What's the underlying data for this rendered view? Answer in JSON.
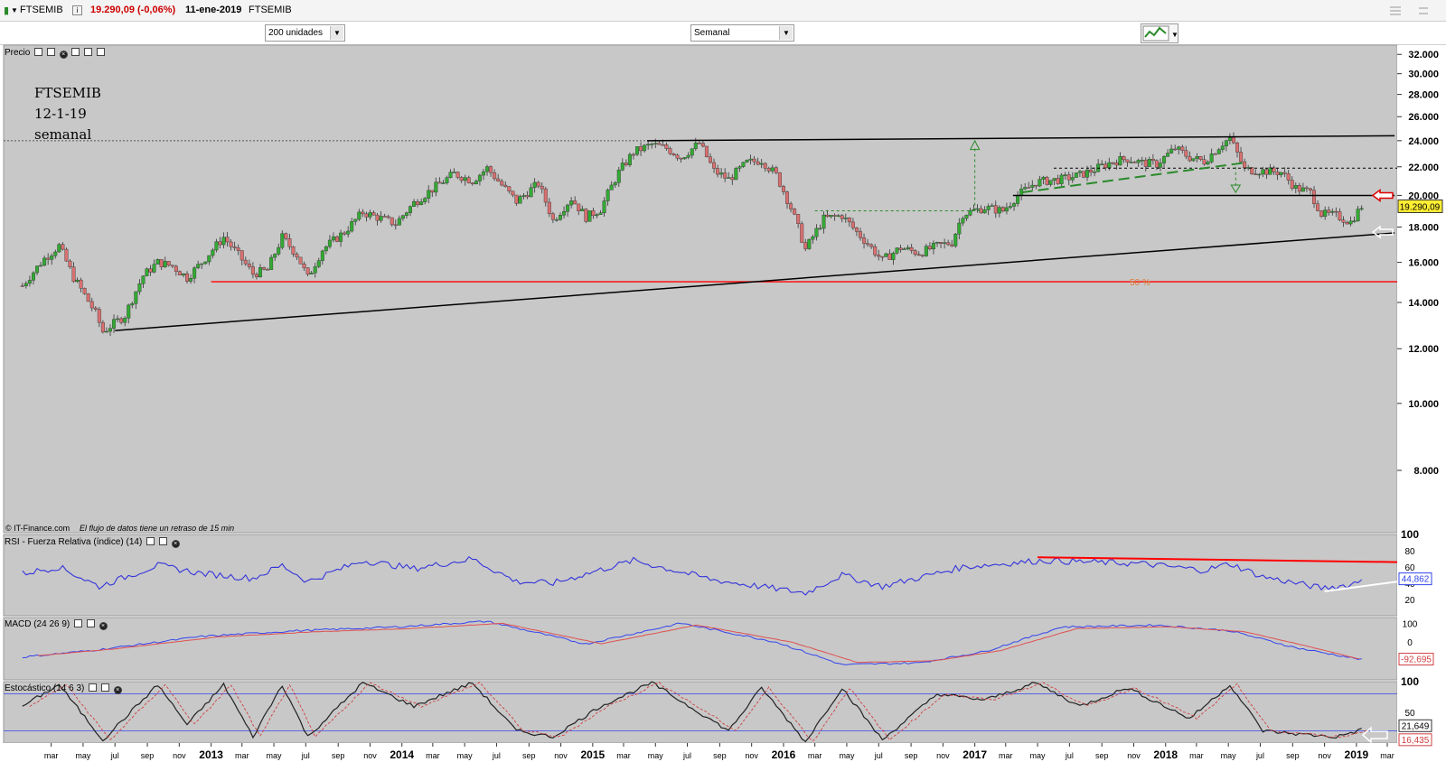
{
  "titlebar": {
    "symbol": "FTSEMIB",
    "quote": "19.290,09 (-0,06%)",
    "date": "11-ene-2019",
    "symbol_right": "FTSEMIB"
  },
  "toolbar": {
    "units_select": "200 unidades",
    "period_select": "Semanal"
  },
  "annotation": {
    "line1": "FTSEMIB",
    "line2": "12-1-19",
    "line3": "semanal"
  },
  "fib_label": "50 %",
  "copyright": "© IT-Finance.com",
  "delay_note": "El flujo de datos tiene un retraso de 15 min",
  "price_panel": {
    "label": "Precio",
    "last_value": "19.290,09"
  },
  "rsi_panel": {
    "label": "RSI - Fuerza Relativa (índice) (14)",
    "last_value": "44,862"
  },
  "macd_panel": {
    "label": "MACD (24 26 9)",
    "last_value": "-92,695"
  },
  "stoch_panel": {
    "label": "Estocástico (14 6 3)",
    "last_value_k": "21,649",
    "last_value_d": "16,435"
  },
  "colors": {
    "chart_bg": "#c8c8c8",
    "up_candle": "#33aa33",
    "down_candle": "#d97070",
    "trendline": "#000000",
    "support_red": "#ff0000",
    "rsi_line": "#3333dd",
    "macd_line": "#3344ee",
    "signal_line": "#e05050",
    "fib_dashed": "#2a8a2a"
  },
  "chart_data": {
    "type": "candlestick",
    "title": "FTSEMIB",
    "period": "semanal",
    "price_axis_ticks": [
      "8.000",
      "10.000",
      "12.000",
      "14.000",
      "16.000",
      "18.000",
      "20.000",
      "22.000",
      "24.000",
      "26.000",
      "28.000",
      "30.000",
      "32.000"
    ],
    "price_axis_values": [
      8000,
      10000,
      12000,
      14000,
      16000,
      18000,
      20000,
      22000,
      24000,
      26000,
      28000,
      30000,
      32000
    ],
    "ylim": [
      6500,
      33000
    ],
    "scale": "log",
    "x_axis_ticks": [
      "mar",
      "may",
      "jul",
      "sep",
      "nov",
      "2013",
      "mar",
      "may",
      "jul",
      "sep",
      "nov",
      "2014",
      "mar",
      "may",
      "jul",
      "sep",
      "nov",
      "2015",
      "mar",
      "may",
      "jul",
      "sep",
      "nov",
      "2016",
      "mar",
      "may",
      "jul",
      "sep",
      "nov",
      "2017",
      "mar",
      "may",
      "jul",
      "sep",
      "nov",
      "2018",
      "mar",
      "may",
      "jul",
      "sep",
      "nov",
      "2019",
      "mar"
    ],
    "x_axis_dates": [
      "2012-03",
      "2012-05",
      "2012-07",
      "2012-09",
      "2012-11",
      "2013-01",
      "2013-03",
      "2013-05",
      "2013-07",
      "2013-09",
      "2013-11",
      "2014-01",
      "2014-03",
      "2014-05",
      "2014-07",
      "2014-09",
      "2014-11",
      "2015-01",
      "2015-03",
      "2015-05",
      "2015-07",
      "2015-09",
      "2015-11",
      "2016-01",
      "2016-03",
      "2016-05",
      "2016-07",
      "2016-09",
      "2016-11",
      "2017-01",
      "2017-03",
      "2017-05",
      "2017-07",
      "2017-09",
      "2017-11",
      "2018-01",
      "2018-03",
      "2018-05",
      "2018-07",
      "2018-09",
      "2018-11",
      "2019-01",
      "2019-03"
    ],
    "year_labels": [
      "2013",
      "2014",
      "2015",
      "2016",
      "2017",
      "2018",
      "2019"
    ],
    "price_path": [
      [
        "2012-01-06",
        14800
      ],
      [
        "2012-02-17",
        16200
      ],
      [
        "2012-03-16",
        16900
      ],
      [
        "2012-04-13",
        15200
      ],
      [
        "2012-05-25",
        13500
      ],
      [
        "2012-06-08",
        12700
      ],
      [
        "2012-07-20",
        13400
      ],
      [
        "2012-08-24",
        15300
      ],
      [
        "2012-09-21",
        16000
      ],
      [
        "2012-10-19",
        15800
      ],
      [
        "2012-11-16",
        15200
      ],
      [
        "2012-12-14",
        16000
      ],
      [
        "2013-01-25",
        17400
      ],
      [
        "2013-02-22",
        16400
      ],
      [
        "2013-03-22",
        15400
      ],
      [
        "2013-04-19",
        15600
      ],
      [
        "2013-05-17",
        17400
      ],
      [
        "2013-06-14",
        16400
      ],
      [
        "2013-07-05",
        15200
      ],
      [
        "2013-08-02",
        16700
      ],
      [
        "2013-09-13",
        17700
      ],
      [
        "2013-10-18",
        18900
      ],
      [
        "2013-11-15",
        18600
      ],
      [
        "2013-12-20",
        18200
      ],
      [
        "2014-01-24",
        19500
      ],
      [
        "2014-03-07",
        20600
      ],
      [
        "2014-04-11",
        21500
      ],
      [
        "2014-05-16",
        21000
      ],
      [
        "2014-06-13",
        21900
      ],
      [
        "2014-07-11",
        20700
      ],
      [
        "2014-08-08",
        19600
      ],
      [
        "2014-09-19",
        20800
      ],
      [
        "2014-10-17",
        18400
      ],
      [
        "2014-11-21",
        19800
      ],
      [
        "2014-12-19",
        18600
      ],
      [
        "2015-01-16",
        19100
      ],
      [
        "2015-02-20",
        21600
      ],
      [
        "2015-03-20",
        23100
      ],
      [
        "2015-04-24",
        23700
      ],
      [
        "2015-05-22",
        23400
      ],
      [
        "2015-06-19",
        22700
      ],
      [
        "2015-07-24",
        23800
      ],
      [
        "2015-08-21",
        21700
      ],
      [
        "2015-09-18",
        21100
      ],
      [
        "2015-10-23",
        22300
      ],
      [
        "2015-11-20",
        22500
      ],
      [
        "2015-12-18",
        21400
      ],
      [
        "2016-01-15",
        19200
      ],
      [
        "2016-02-12",
        16700
      ],
      [
        "2016-03-18",
        18500
      ],
      [
        "2016-04-22",
        18700
      ],
      [
        "2016-05-20",
        17700
      ],
      [
        "2016-06-17",
        16800
      ],
      [
        "2016-07-08",
        16100
      ],
      [
        "2016-08-12",
        16800
      ],
      [
        "2016-09-16",
        16500
      ],
      [
        "2016-10-21",
        16900
      ],
      [
        "2016-11-18",
        17100
      ],
      [
        "2016-12-09",
        18800
      ],
      [
        "2017-01-20",
        19200
      ],
      [
        "2017-02-24",
        19000
      ],
      [
        "2017-03-24",
        20000
      ],
      [
        "2017-04-28",
        20900
      ],
      [
        "2017-05-19",
        21000
      ],
      [
        "2017-06-16",
        21100
      ],
      [
        "2017-07-21",
        21400
      ],
      [
        "2017-08-18",
        21800
      ],
      [
        "2017-09-22",
        22400
      ],
      [
        "2017-10-20",
        22600
      ],
      [
        "2017-11-17",
        22300
      ],
      [
        "2017-12-15",
        22200
      ],
      [
        "2018-01-19",
        23400
      ],
      [
        "2018-02-16",
        22700
      ],
      [
        "2018-03-16",
        22400
      ],
      [
        "2018-04-20",
        23800
      ],
      [
        "2018-05-04",
        24200
      ],
      [
        "2018-06-01",
        21800
      ],
      [
        "2018-07-06",
        21700
      ],
      [
        "2018-08-10",
        21600
      ],
      [
        "2018-09-07",
        20500
      ],
      [
        "2018-10-05",
        20200
      ],
      [
        "2018-10-26",
        18800
      ],
      [
        "2018-11-23",
        18700
      ],
      [
        "2018-12-21",
        18300
      ],
      [
        "2019-01-11",
        19290
      ]
    ],
    "trendlines": [
      {
        "from": [
          "2012-07-01",
          12750
        ],
        "to": [
          "2019-03-15",
          17650
        ]
      },
      {
        "from": [
          "2015-04-15",
          24000
        ],
        "to": [
          "2019-03-15",
          24400
        ]
      },
      {
        "from": [
          "2017-03-15",
          20000
        ],
        "to": [
          "2019-03-15",
          20000
        ]
      }
    ],
    "support_level": 15000,
    "resistance_dashed": 24000,
    "rsi": {
      "axis_ticks": [
        "20",
        "40",
        "60",
        "80",
        "100"
      ],
      "ylim": [
        0,
        100
      ],
      "last": 44.862,
      "path": [
        [
          "2012-01-06",
          52
        ],
        [
          "2012-03-16",
          60
        ],
        [
          "2012-06-01",
          36
        ],
        [
          "2012-09-21",
          62
        ],
        [
          "2012-12-14",
          52
        ],
        [
          "2013-03-22",
          46
        ],
        [
          "2013-05-17",
          62
        ],
        [
          "2013-07-05",
          42
        ],
        [
          "2013-10-18",
          68
        ],
        [
          "2014-01-24",
          58
        ],
        [
          "2014-05-16",
          70
        ],
        [
          "2014-08-08",
          42
        ],
        [
          "2014-10-17",
          40
        ],
        [
          "2015-03-20",
          68
        ],
        [
          "2015-08-21",
          44
        ],
        [
          "2016-02-12",
          28
        ],
        [
          "2016-04-22",
          50
        ],
        [
          "2016-07-08",
          36
        ],
        [
          "2016-12-09",
          60
        ],
        [
          "2017-05-12",
          68
        ],
        [
          "2017-11-17",
          64
        ],
        [
          "2018-03-16",
          56
        ],
        [
          "2018-05-04",
          64
        ],
        [
          "2018-07-06",
          48
        ],
        [
          "2018-10-26",
          34
        ],
        [
          "2018-12-21",
          38
        ],
        [
          "2019-01-11",
          44.862
        ]
      ]
    },
    "macd": {
      "axis_ticks": [
        "0",
        "100"
      ],
      "ylim": [
        -200,
        130
      ],
      "last": -92.695,
      "path": [
        [
          "2012-01-06",
          -80
        ],
        [
          "2012-06-01",
          -40
        ],
        [
          "2012-12-14",
          30
        ],
        [
          "2013-06-14",
          60
        ],
        [
          "2013-12-20",
          80
        ],
        [
          "2014-06-13",
          110
        ],
        [
          "2014-12-19",
          -10
        ],
        [
          "2015-06-19",
          100
        ],
        [
          "2015-12-18",
          0
        ],
        [
          "2016-04-22",
          -120
        ],
        [
          "2016-09-16",
          -110
        ],
        [
          "2017-01-20",
          -50
        ],
        [
          "2017-06-16",
          80
        ],
        [
          "2017-12-15",
          90
        ],
        [
          "2018-05-04",
          60
        ],
        [
          "2018-09-07",
          -30
        ],
        [
          "2019-01-11",
          -92.695
        ]
      ]
    },
    "stochastic": {
      "axis_ticks": [
        "50",
        "100"
      ],
      "ylim": [
        0,
        100
      ],
      "last_k": 21.649,
      "last_d": 16.435,
      "levels": [
        20,
        80
      ],
      "path": [
        [
          "2012-01-06",
          60
        ],
        [
          "2012-03-16",
          95
        ],
        [
          "2012-06-08",
          5
        ],
        [
          "2012-09-21",
          95
        ],
        [
          "2012-11-16",
          30
        ],
        [
          "2013-01-25",
          95
        ],
        [
          "2013-03-22",
          10
        ],
        [
          "2013-05-17",
          95
        ],
        [
          "2013-07-05",
          10
        ],
        [
          "2013-10-18",
          98
        ],
        [
          "2014-01-24",
          60
        ],
        [
          "2014-05-16",
          98
        ],
        [
          "2014-08-08",
          20
        ],
        [
          "2014-10-17",
          10
        ],
        [
          "2015-01-16",
          60
        ],
        [
          "2015-04-24",
          98
        ],
        [
          "2015-09-18",
          20
        ],
        [
          "2015-11-20",
          90
        ],
        [
          "2016-02-12",
          2
        ],
        [
          "2016-04-22",
          90
        ],
        [
          "2016-07-08",
          5
        ],
        [
          "2016-10-21",
          80
        ],
        [
          "2017-01-20",
          70
        ],
        [
          "2017-04-28",
          98
        ],
        [
          "2017-07-21",
          60
        ],
        [
          "2017-10-20",
          90
        ],
        [
          "2018-02-16",
          40
        ],
        [
          "2018-05-04",
          95
        ],
        [
          "2018-07-06",
          20
        ],
        [
          "2018-09-07",
          15
        ],
        [
          "2018-11-23",
          10
        ],
        [
          "2019-01-11",
          21.649
        ]
      ]
    }
  }
}
